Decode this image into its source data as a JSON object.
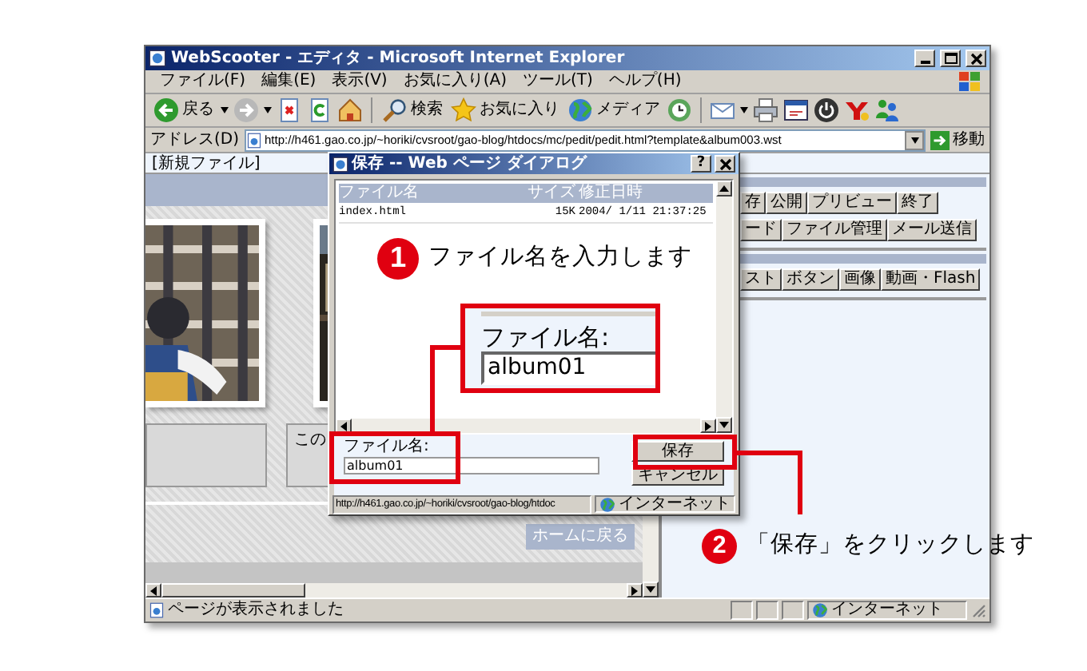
{
  "browser": {
    "title": "WebScooter - エディタ - Microsoft Internet Explorer",
    "menu": [
      "ファイル(F)",
      "編集(E)",
      "表示(V)",
      "お気に入り(A)",
      "ツール(T)",
      "ヘルプ(H)"
    ],
    "toolbar": [
      {
        "kind": "back",
        "label": "戻る"
      },
      {
        "kind": "forward"
      },
      {
        "kind": "stop"
      },
      {
        "kind": "refresh"
      },
      {
        "kind": "home"
      },
      {
        "kind": "search",
        "label": "検索"
      },
      {
        "kind": "favorites",
        "label": "お気に入り"
      },
      {
        "kind": "media",
        "label": "メディア"
      },
      {
        "kind": "history"
      },
      {
        "kind": "mail"
      },
      {
        "kind": "print"
      },
      {
        "kind": "edit"
      },
      {
        "kind": "power"
      },
      {
        "kind": "yahoo"
      },
      {
        "kind": "messenger"
      }
    ],
    "address": {
      "label": "アドレス(D)",
      "url": "http://h461.gao.co.jp/~horiki/cvsroot/gao-blog/htdocs/mc/pedit/pedit.html?template&album003.wst",
      "go": "移動"
    },
    "page_title": "[新規ファイル]",
    "page": {
      "partial_text": "この",
      "home_button": "ホームに戻る"
    },
    "side_panel": [
      {
        "buttons": [
          "存",
          "公開",
          "プリビュー",
          "終了"
        ]
      },
      {
        "buttons": [
          "ード",
          "ファイル管理",
          "メール送信"
        ]
      },
      {
        "buttons": [
          "スト",
          "ボタン",
          "画像",
          "動画・Flash"
        ]
      }
    ],
    "status": {
      "text": "ページが表示されました",
      "zone": "インターネット"
    }
  },
  "dialog": {
    "title": "保存 -- Web ページ ダイアログ",
    "help": "?",
    "columns": [
      "ファイル名",
      "サイズ",
      "修正日時"
    ],
    "files": [
      {
        "name": "index.html",
        "size": "15K",
        "modified": "2004/ 1/11 21:37:25"
      }
    ],
    "field_label": "ファイル名:",
    "field_value": "album01",
    "buttons": [
      "保存",
      "キャンセル"
    ],
    "status_url": "http://h461.gao.co.jp/~horiki/cvsroot/gao-blog/htdoc",
    "zone": "インターネット"
  },
  "inset": {
    "label": "ファイル名:",
    "value": "album01"
  },
  "steps": [
    {
      "number": "1",
      "text": "ファイル名を入力します"
    },
    {
      "number": "2",
      "text": "「保存」をクリックします"
    }
  ]
}
